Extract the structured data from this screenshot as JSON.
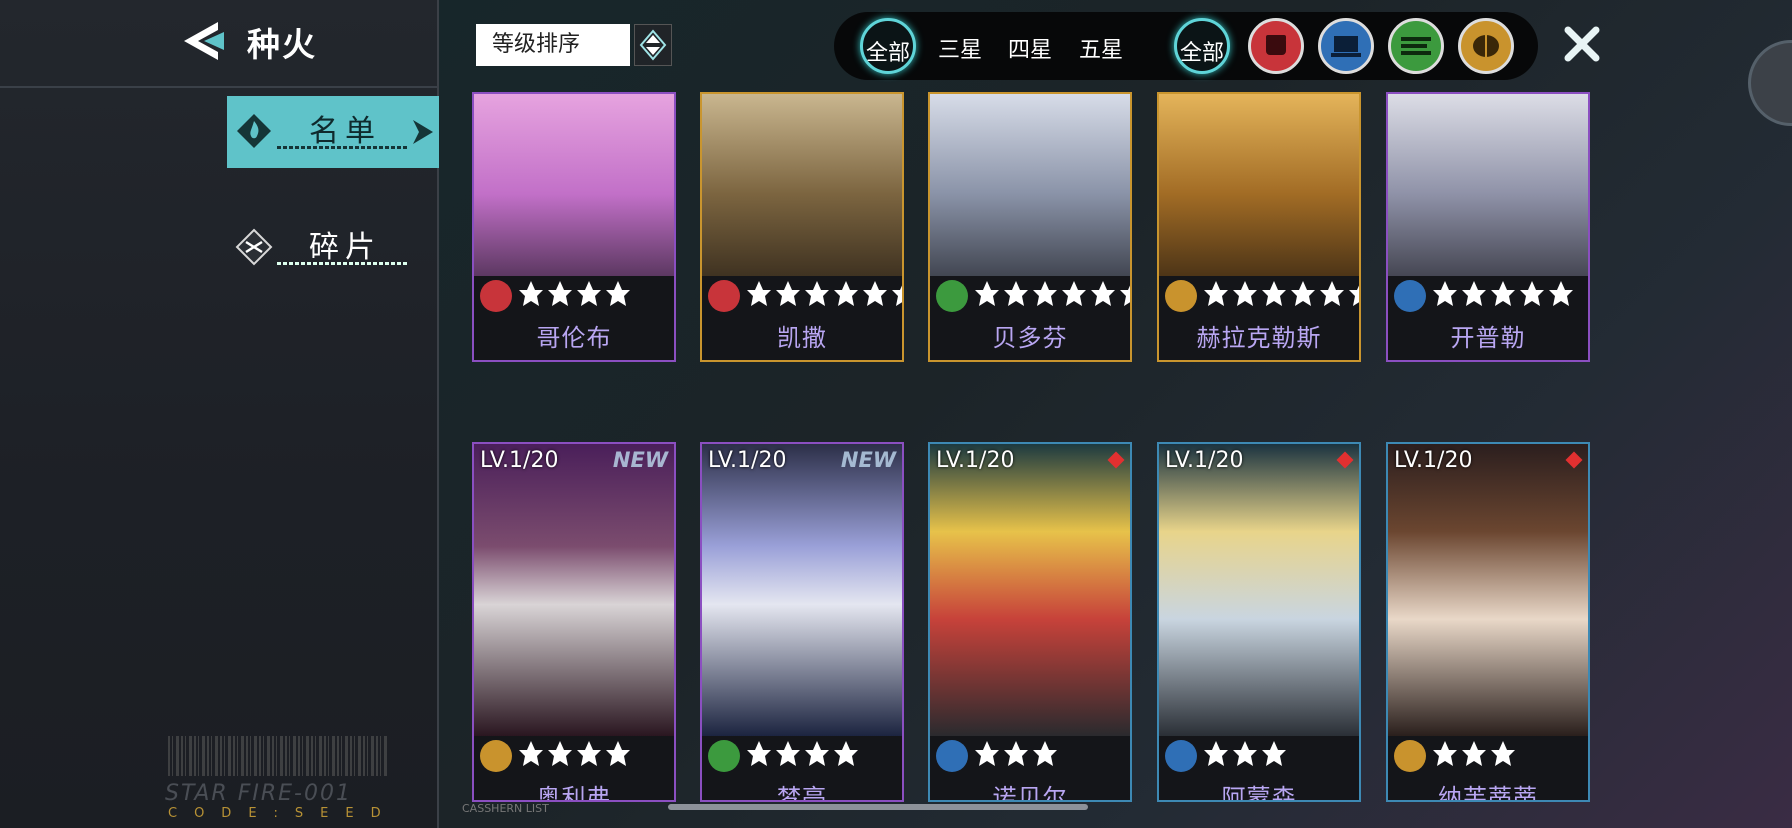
{
  "header": {
    "title": "种火"
  },
  "sidebar": {
    "items": [
      {
        "label": "名单",
        "active": true
      },
      {
        "label": "碎片",
        "active": false
      }
    ],
    "code_text": "STAR FIRE-001",
    "code_sub": "CODE:SEED"
  },
  "sort": {
    "label": "等级排序"
  },
  "filters": {
    "rarity": [
      "全部",
      "三星",
      "四星",
      "五星"
    ],
    "class_all": "全部",
    "classes": [
      "fist-icon",
      "computer-icon",
      "speed-icon",
      "brain-icon"
    ]
  },
  "colors": {
    "accent": "#5fc3c9",
    "epic_border": "#8b4fc1",
    "legend_border": "#c9952e",
    "rare_border": "#3d89b4",
    "name_text": "#b9a6f2"
  },
  "cards_row1": [
    {
      "name": "哥伦布",
      "class_icon": "fist-icon",
      "stars": 4,
      "border": "purple"
    },
    {
      "name": "凯撒",
      "class_icon": "fist-icon",
      "stars": 6,
      "border": "gold"
    },
    {
      "name": "贝多芬",
      "class_icon": "speed-icon",
      "stars": 6,
      "border": "gold"
    },
    {
      "name": "赫拉克勒斯",
      "class_icon": "brain-icon",
      "stars": 6,
      "border": "gold"
    },
    {
      "name": "开普勒",
      "class_icon": "computer-icon",
      "stars": 5,
      "border": "purple"
    }
  ],
  "cards_row2": [
    {
      "name": "奥利弗",
      "level": "LV.1/20",
      "tag": "NEW",
      "class_icon": "brain-icon",
      "stars": 4,
      "border": "purple"
    },
    {
      "name": "梦亭",
      "level": "LV.1/20",
      "tag": "NEW",
      "class_icon": "speed-icon",
      "stars": 4,
      "border": "purple"
    },
    {
      "name": "诺贝尔",
      "level": "LV.1/20",
      "class_icon": "computer-icon",
      "stars": 3,
      "border": "blue"
    },
    {
      "name": "阿蒙森",
      "level": "LV.1/20",
      "class_icon": "computer-icon",
      "stars": 3,
      "border": "blue"
    },
    {
      "name": "纳芙蒂蒂",
      "level": "LV.1/20",
      "class_icon": "brain-icon",
      "stars": 3,
      "border": "blue"
    }
  ],
  "footer": {
    "caption": "CASSHERN LIST"
  }
}
